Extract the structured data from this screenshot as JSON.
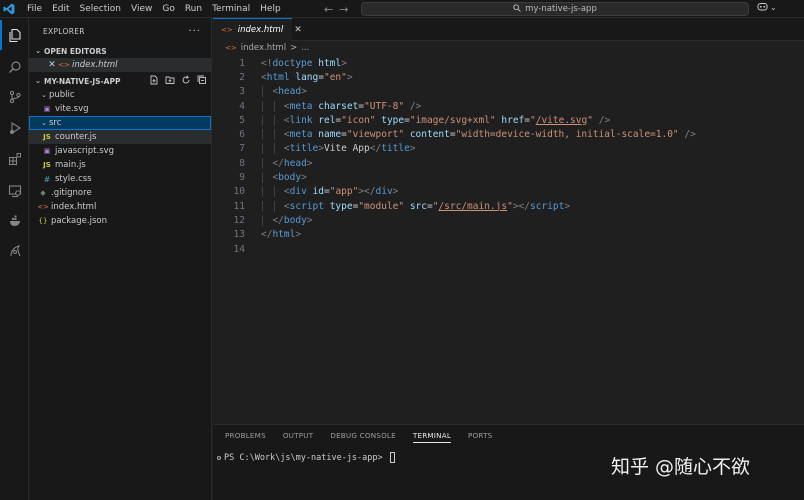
{
  "titlebar": {
    "menu": [
      "File",
      "Edit",
      "Selection",
      "View",
      "Go",
      "Run",
      "Terminal",
      "Help"
    ],
    "search_text": "my-native-js-app",
    "accent": "#0078d4"
  },
  "activity_icons": [
    "explorer-icon",
    "search-icon",
    "source-control-icon",
    "run-debug-icon",
    "extensions-icon",
    "remote-explorer-icon",
    "docker-icon",
    "account-icon"
  ],
  "sidebar": {
    "title": "EXPLORER",
    "open_editors_label": "OPEN EDITORS",
    "open_editor_file": "index.html",
    "project_label": "MY-NATIVE-JS-APP",
    "tree": [
      {
        "label": "public",
        "type": "folder",
        "depth": 1
      },
      {
        "label": "vite.svg",
        "type": "svg",
        "depth": 2
      },
      {
        "label": "src",
        "type": "folder",
        "depth": 1
      },
      {
        "label": "counter.js",
        "type": "js",
        "depth": 2
      },
      {
        "label": "javascript.svg",
        "type": "svg",
        "depth": 2
      },
      {
        "label": "main.js",
        "type": "js",
        "depth": 2
      },
      {
        "label": "style.css",
        "type": "css",
        "depth": 2
      },
      {
        "label": ".gitignore",
        "type": "git",
        "depth": 1
      },
      {
        "label": "index.html",
        "type": "html",
        "depth": 1
      },
      {
        "label": "package.json",
        "type": "json",
        "depth": 1
      }
    ]
  },
  "editor": {
    "tab_label": "index.html",
    "breadcrumb": "index.html",
    "breadcrumb_sep": ">",
    "line_numbers": [
      "1",
      "2",
      "3",
      "4",
      "5",
      "6",
      "7",
      "8",
      "9",
      "10",
      "11",
      "12",
      "13",
      "14"
    ]
  },
  "panel": {
    "tabs": [
      "PROBLEMS",
      "OUTPUT",
      "DEBUG CONSOLE",
      "TERMINAL",
      "PORTS"
    ],
    "active_tab": "TERMINAL",
    "prompt": "PS C:\\Work\\js\\my-native-js-app> "
  },
  "watermark": "知乎 @随心不欲"
}
